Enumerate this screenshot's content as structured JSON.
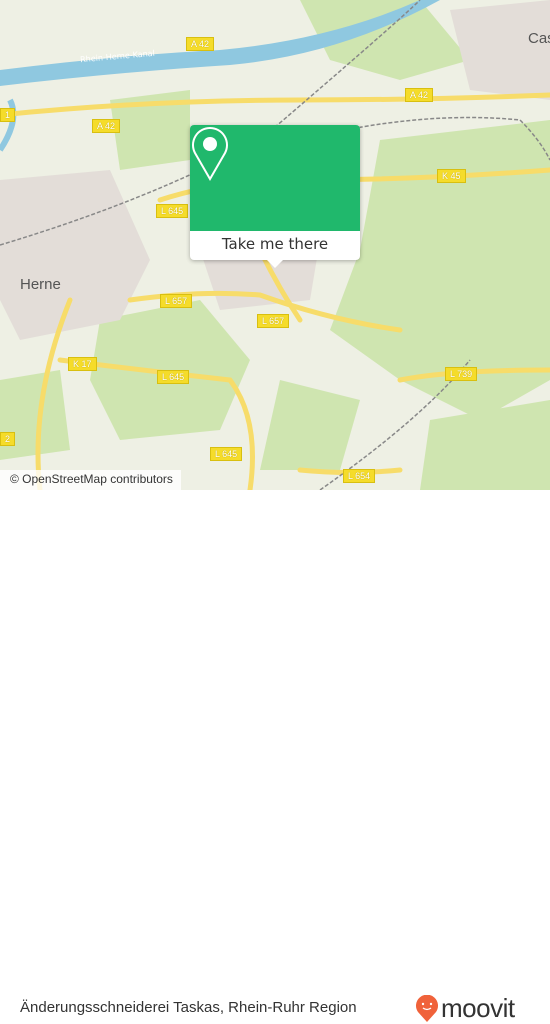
{
  "map": {
    "places": {
      "herne": "Herne",
      "castrop": "Cas"
    },
    "canal": "Rhein-Herne-Kanal",
    "road_labels": [
      "A 42",
      "A 42",
      "A 42",
      "K 45",
      "L 645",
      "L 645",
      "L 645",
      "L 657",
      "L 657",
      "K 17",
      "L 739",
      "L 654",
      "1",
      "2"
    ],
    "attribution": "© OpenStreetMap contributors",
    "colors": {
      "land": "#eef0e4",
      "forest": "#cfe5b0",
      "water": "#8fc8e0",
      "road": "#f7dc6a",
      "accent": "#20b86c"
    }
  },
  "popup": {
    "icon": "map-pin-icon",
    "button_label": "Take me there"
  },
  "footer": {
    "title": "Änderungsschneiderei Taskas, Rhein-Ruhr Region",
    "brand": "moovit",
    "brand_color": "#f0623a"
  }
}
